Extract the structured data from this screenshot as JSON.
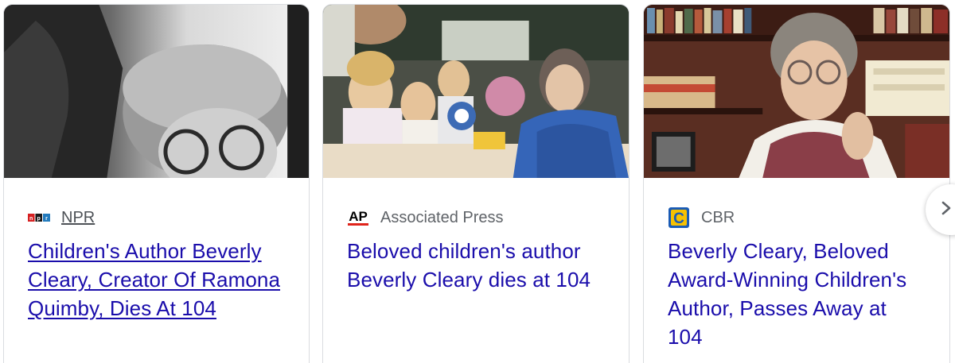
{
  "cards": [
    {
      "source": "NPR",
      "logo_icon": "npr-logo-icon",
      "headline": "Children's Author Beverly Cleary, Creator Of Ramona Quimby, Dies At 104"
    },
    {
      "source": "Associated Press",
      "logo_icon": "ap-logo-icon",
      "logo_text": "AP",
      "headline": "Beloved children's author Beverly Cleary dies at 104"
    },
    {
      "source": "CBR",
      "logo_icon": "cbr-logo-icon",
      "logo_text": "C",
      "headline": "Beverly Cleary, Beloved Award-Winning Children's Author, Passes Away at 104"
    }
  ],
  "colors": {
    "headline_link": "#1a0dab",
    "source_text": "#5f6368",
    "card_border": "#dadce0",
    "ap_red": "#e0241b",
    "cbr_blue": "#1a5bb5",
    "cbr_yellow": "#f7c100"
  },
  "navigation": {
    "next_icon": "chevron-right-icon"
  }
}
